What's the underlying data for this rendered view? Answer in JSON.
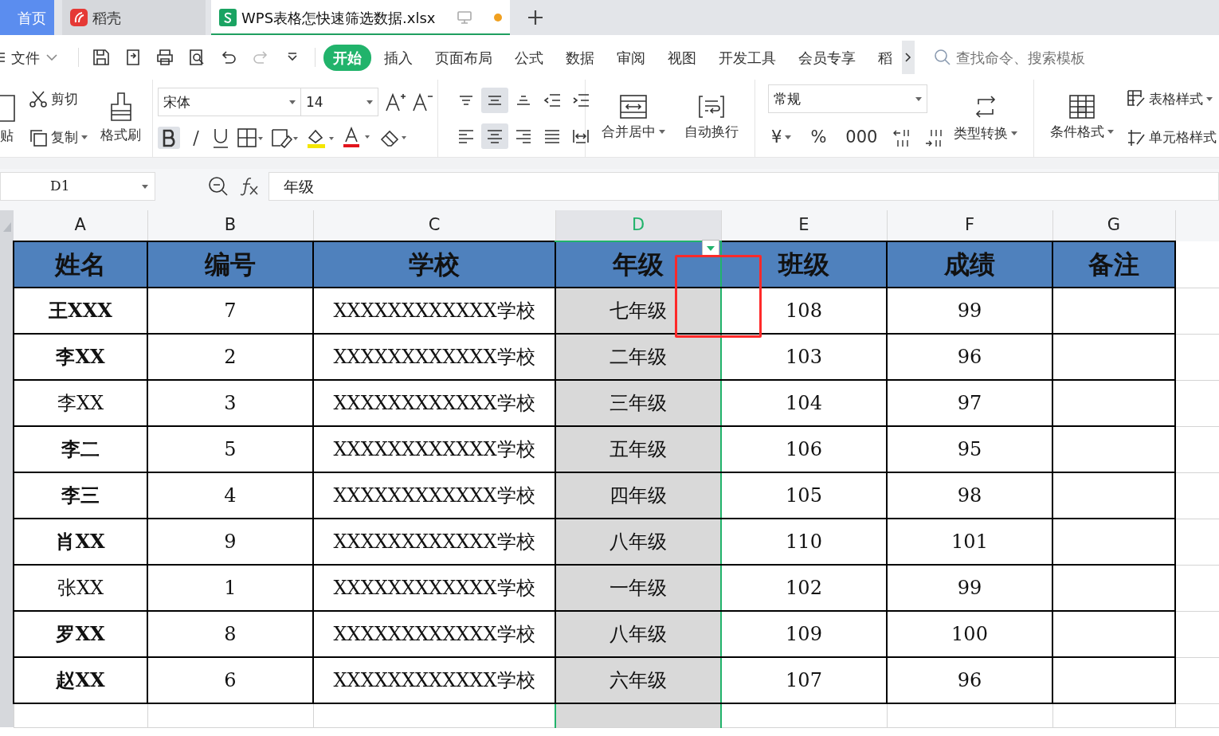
{
  "tabs": [
    {
      "label": "首页",
      "kind": "home",
      "selected": false
    },
    {
      "label": "稻壳",
      "kind": "docer",
      "selected": false
    },
    {
      "label": "WPS表格怎快速筛选数据.xlsx",
      "kind": "file",
      "selected": true,
      "modified": true
    }
  ],
  "menu": {
    "file": "文件",
    "tabs": [
      {
        "label": "开始",
        "selected": true
      },
      {
        "label": "插入",
        "selected": false
      },
      {
        "label": "页面布局",
        "selected": false
      },
      {
        "label": "公式",
        "selected": false
      },
      {
        "label": "数据",
        "selected": false
      },
      {
        "label": "审阅",
        "selected": false
      },
      {
        "label": "视图",
        "selected": false
      },
      {
        "label": "开发工具",
        "selected": false
      },
      {
        "label": "会员专享",
        "selected": false
      },
      {
        "label": "稻",
        "selected": false
      }
    ],
    "search": {
      "placeholder": "查找命令、搜索模板"
    }
  },
  "ribbon": {
    "paste": "贴",
    "cut": "剪切",
    "copy": "复制",
    "format_painter": "格式刷",
    "font": "宋体",
    "font_size": "14",
    "bold": true,
    "vertical_middle": true,
    "horizontal_center": true,
    "merge": "合并居中",
    "wrap": "自动换行",
    "number_format": "常规",
    "number_buttons": [
      "¥",
      "%",
      "000"
    ],
    "convert": "类型转换",
    "conditional": "条件格式",
    "table_style": "表格样式",
    "cell_style": "单元格样式"
  },
  "formula_bar": {
    "cell": "D1",
    "content": "年级"
  },
  "columns": [
    {
      "label": "A",
      "selected": false
    },
    {
      "label": "B",
      "selected": false
    },
    {
      "label": "C",
      "selected": false
    },
    {
      "label": "D",
      "selected": true
    },
    {
      "label": "E",
      "selected": false
    },
    {
      "label": "F",
      "selected": false
    },
    {
      "label": "G",
      "selected": false
    }
  ],
  "table": {
    "headers": [
      {
        "label": "姓名",
        "filter": false
      },
      {
        "label": "编号",
        "filter": false
      },
      {
        "label": "学校",
        "filter": false
      },
      {
        "label": "年级",
        "filter": true
      },
      {
        "label": "班级",
        "filter": false
      },
      {
        "label": "成绩",
        "filter": false
      },
      {
        "label": "备注",
        "filter": false
      }
    ],
    "rows": [
      {
        "cells": [
          "王XXX",
          "7",
          "XXXXXXXXXXXX学校",
          "七年级",
          "108",
          "99",
          ""
        ],
        "bold_name": true
      },
      {
        "cells": [
          "李XX",
          "2",
          "XXXXXXXXXXXX学校",
          "二年级",
          "103",
          "96",
          ""
        ],
        "bold_name": true
      },
      {
        "cells": [
          "李XX",
          "3",
          "XXXXXXXXXXXX学校",
          "三年级",
          "104",
          "97",
          ""
        ],
        "bold_name": false
      },
      {
        "cells": [
          "李二",
          "5",
          "XXXXXXXXXXXX学校",
          "五年级",
          "106",
          "95",
          ""
        ],
        "bold_name": true
      },
      {
        "cells": [
          "李三",
          "4",
          "XXXXXXXXXXXX学校",
          "四年级",
          "105",
          "98",
          ""
        ],
        "bold_name": true
      },
      {
        "cells": [
          "肖XX",
          "9",
          "XXXXXXXXXXXX学校",
          "八年级",
          "110",
          "101",
          ""
        ],
        "bold_name": true
      },
      {
        "cells": [
          "张XX",
          "1",
          "XXXXXXXXXXXX学校",
          "一年级",
          "102",
          "99",
          ""
        ],
        "bold_name": false
      },
      {
        "cells": [
          "罗XX",
          "8",
          "XXXXXXXXXXXX学校",
          "八年级",
          "109",
          "100",
          ""
        ],
        "bold_name": true
      },
      {
        "cells": [
          "赵XX",
          "6",
          "XXXXXXXXXXXX学校",
          "六年级",
          "107",
          "96",
          ""
        ],
        "bold_name": true
      }
    ]
  }
}
